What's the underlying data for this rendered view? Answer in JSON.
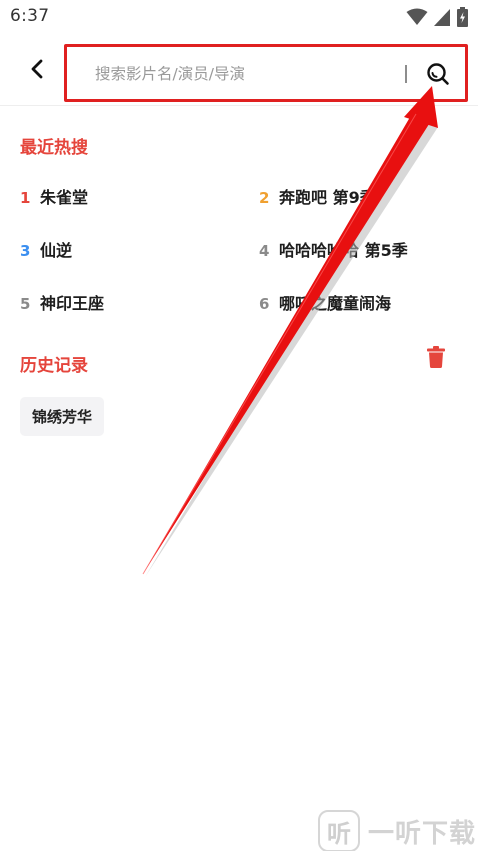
{
  "status_bar": {
    "time": "6:37"
  },
  "search": {
    "placeholder": "搜索影片名/演员/导演",
    "value": ""
  },
  "hot_search": {
    "title": "最近热搜",
    "items": [
      {
        "rank": "1",
        "name": "朱雀堂",
        "color": "#e5453c"
      },
      {
        "rank": "2",
        "name": "奔跑吧 第9季",
        "color": "#f0a030"
      },
      {
        "rank": "3",
        "name": "仙逆",
        "color": "#3b8ff0"
      },
      {
        "rank": "4",
        "name": "哈哈哈哈哈 第5季",
        "color": "#8a8a8a"
      },
      {
        "rank": "5",
        "name": "神印王座",
        "color": "#8a8a8a"
      },
      {
        "rank": "6",
        "name": "哪吒之魔童闹海",
        "color": "#8a8a8a"
      }
    ]
  },
  "history": {
    "title": "历史记录",
    "items": [
      "锦绣芳华"
    ]
  },
  "watermark": {
    "text": "一听下载",
    "logo": "听"
  },
  "colors": {
    "accent": "#e5453c",
    "highlight_border": "#e02020",
    "arrow": "#e81010"
  },
  "icons": [
    "back-arrow-icon",
    "search-icon",
    "trash-icon",
    "wifi-icon",
    "signal-icon",
    "battery-icon"
  ]
}
